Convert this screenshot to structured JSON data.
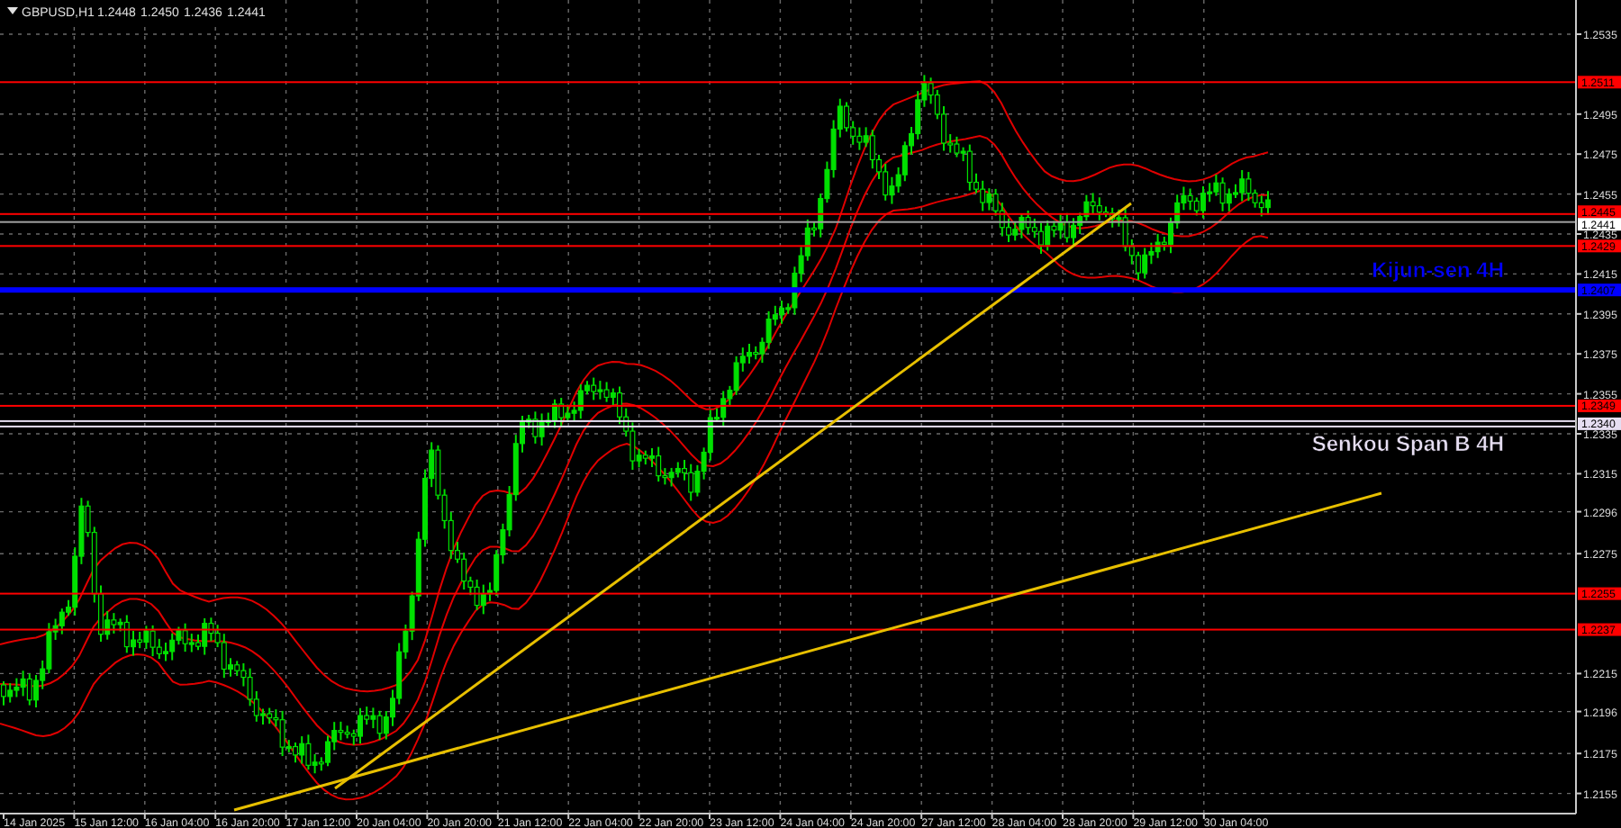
{
  "header": {
    "symbol": "GBPUSD,H1",
    "ohlc": [
      "1.2448",
      "1.2450",
      "1.2436",
      "1.2441"
    ]
  },
  "price_axis": [
    "1.2535",
    "1.2495",
    "1.2475",
    "1.2455",
    "1.2435",
    "1.2415",
    "1.2395",
    "1.2375",
    "1.2355",
    "1.2335",
    "1.2315",
    "1.2296",
    "1.2275",
    "1.2215",
    "1.2196",
    "1.2175",
    "1.2155"
  ],
  "time_axis": [
    "14 Jan 2025",
    "15 Jan 12:00",
    "16 Jan 04:00",
    "16 Jan 20:00",
    "17 Jan 12:00",
    "20 Jan 04:00",
    "20 Jan 20:00",
    "21 Jan 12:00",
    "22 Jan 04:00",
    "22 Jan 20:00",
    "23 Jan 12:00",
    "24 Jan 04:00",
    "24 Jan 20:00",
    "27 Jan 12:00",
    "28 Jan 04:00",
    "28 Jan 20:00",
    "29 Jan 12:00",
    "30 Jan 04:00"
  ],
  "levels": [
    {
      "kind": "level",
      "price": "1.2511",
      "color": "#ff0000"
    },
    {
      "kind": "level",
      "price": "1.2445",
      "color": "#ff0000"
    },
    {
      "kind": "current",
      "price": "1.2441",
      "color": "#ffffff"
    },
    {
      "kind": "level",
      "price": "1.2429",
      "color": "#ff0000"
    },
    {
      "kind": "kijun",
      "price": "1.2407",
      "color": "#0000ff",
      "caption": "Kijun-sen 4H"
    },
    {
      "kind": "level",
      "price": "1.2349",
      "color": "#ff0000"
    },
    {
      "kind": "senkou",
      "price": "1.2340",
      "color": "#e6def2",
      "caption": "Senkou Span B 4H"
    },
    {
      "kind": "level",
      "price": "1.2255",
      "color": "#ff0000"
    },
    {
      "kind": "level",
      "price": "1.2237",
      "color": "#ff0000"
    }
  ]
}
